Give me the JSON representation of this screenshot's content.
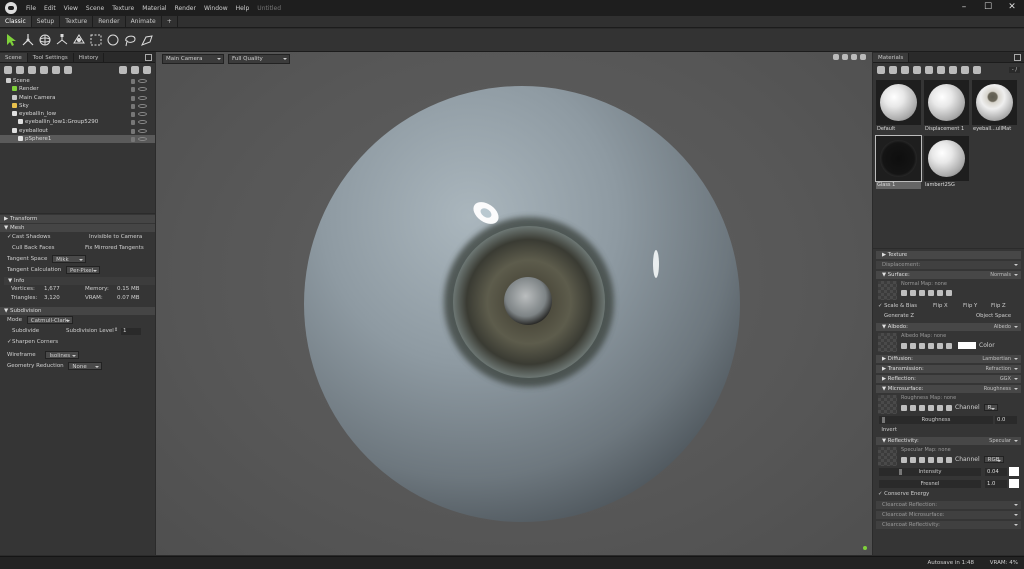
{
  "app": {
    "title": "Untitled"
  },
  "menu": [
    "File",
    "Edit",
    "View",
    "Scene",
    "Texture",
    "Material",
    "Render",
    "Window",
    "Help"
  ],
  "modes": [
    "Classic",
    "Setup",
    "Texture",
    "Render",
    "Animate",
    "+"
  ],
  "left": {
    "tabs": [
      "Scene",
      "Tool Settings",
      "History"
    ],
    "tree": [
      {
        "label": "Scene",
        "indent": 0,
        "sel": false,
        "icon": "scene-icon"
      },
      {
        "label": "Render",
        "indent": 1,
        "sel": false,
        "icon": "render-icon"
      },
      {
        "label": "Main Camera",
        "indent": 1,
        "sel": false,
        "icon": "camera-icon"
      },
      {
        "label": "Sky",
        "indent": 1,
        "sel": false,
        "icon": "sky-icon"
      },
      {
        "label": "eyeballin_low",
        "indent": 1,
        "sel": false,
        "icon": "mesh-icon"
      },
      {
        "label": "eyeballin_low1:Group5290",
        "indent": 2,
        "sel": false,
        "icon": "mesh-icon"
      },
      {
        "label": "eyeballout",
        "indent": 1,
        "sel": false,
        "icon": "mesh-icon"
      },
      {
        "label": "pSphere1",
        "indent": 2,
        "sel": true,
        "icon": "mesh-icon"
      }
    ],
    "props": {
      "transform": "Transform",
      "mesh": "Mesh",
      "cast_shadows": "Cast Shadows",
      "invisible_to_camera": "Invisible to Camera",
      "cull_back_faces": "Cull Back Faces",
      "fix_mirrored_tangents": "Fix Mirrored Tangents",
      "tangent_space": "Tangent Space",
      "tangent_space_val": "Mikk",
      "tangent_calc": "Tangent Calculation",
      "tangent_calc_val": "Per-Pixel",
      "info": "Info",
      "vertices_label": "Vertices:",
      "vertices": "1,677",
      "memory_label": "Memory:",
      "memory": "0.15 MB",
      "triangles_label": "Triangles:",
      "triangles": "3,120",
      "vram_label": "VRAM:",
      "vram": "0.07 MB",
      "subdivision": "Subdivision",
      "mode_label": "Mode",
      "mode_val": "Catmull-Clark",
      "subdivide": "Subdivide",
      "subdiv_level_label": "Subdivision Level",
      "subdiv_level": "1",
      "sharpen_corners": "Sharpen Corners",
      "wireframe_label": "Wireframe",
      "wireframe_val": "Isolines",
      "geo_reduction_label": "Geometry Reduction",
      "geo_reduction_val": "None"
    }
  },
  "viewport": {
    "camera": "Main Camera",
    "quality": "Full Quality"
  },
  "materials": {
    "tab": "Materials",
    "counter": "- /",
    "items": [
      {
        "label": "Default",
        "kind": "white",
        "sel": false
      },
      {
        "label": "Displacement 1",
        "kind": "white",
        "sel": false
      },
      {
        "label": "eyeball...ullMat",
        "kind": "eye",
        "sel": false
      },
      {
        "label": "Glass 1",
        "kind": "glass",
        "sel": true
      },
      {
        "label": "lambert2SG",
        "kind": "white",
        "sel": false
      }
    ],
    "texture": "Texture",
    "displacement": "Displacement:",
    "surface": "Surface:",
    "surface_val": "Normals",
    "normal_map": "Normal Map: none",
    "scale_bias": "Scale & Bias",
    "flip_x": "Flip X",
    "flip_y": "Flip Y",
    "flip_z": "Flip Z",
    "generate_z": "Generate Z",
    "object_space": "Object Space",
    "albedo": "Albedo:",
    "albedo_val": "Albedo",
    "albedo_map": "Albedo Map: none",
    "color": "Color",
    "diffusion": "Diffusion:",
    "diffusion_val": "Lambertian",
    "transmission": "Transmission:",
    "transmission_val": "Refraction",
    "reflection": "Reflection:",
    "reflection_val": "GGX",
    "microsurface": "Microsurface:",
    "microsurface_val": "Roughness",
    "roughness_map": "Roughness Map: none",
    "channel": "Channel",
    "channel_r": "R",
    "roughness": "Roughness",
    "roughness_val": "0.0",
    "invert": "Invert",
    "reflectivity": "Reflectivity:",
    "reflectivity_val": "Specular",
    "specular_map": "Specular Map: none",
    "channel_rgb": "RGB",
    "intensity": "Intensity",
    "intensity_val": "0.04",
    "fresnel": "Fresnel",
    "fresnel_val": "1.0",
    "conserve_energy": "Conserve Energy",
    "clearcoat_reflection": "Clearcoat Reflection:",
    "clearcoat_microsurface": "Clearcoat Microsurface:",
    "clearcoat_reflectivity": "Clearcoat Reflectivity:"
  },
  "status": {
    "autosave": "Autosave in 1:48",
    "vram": "VRAM: 4%"
  },
  "colors": {
    "accent": "#7fd13b",
    "selected": "#5a5a5a"
  }
}
